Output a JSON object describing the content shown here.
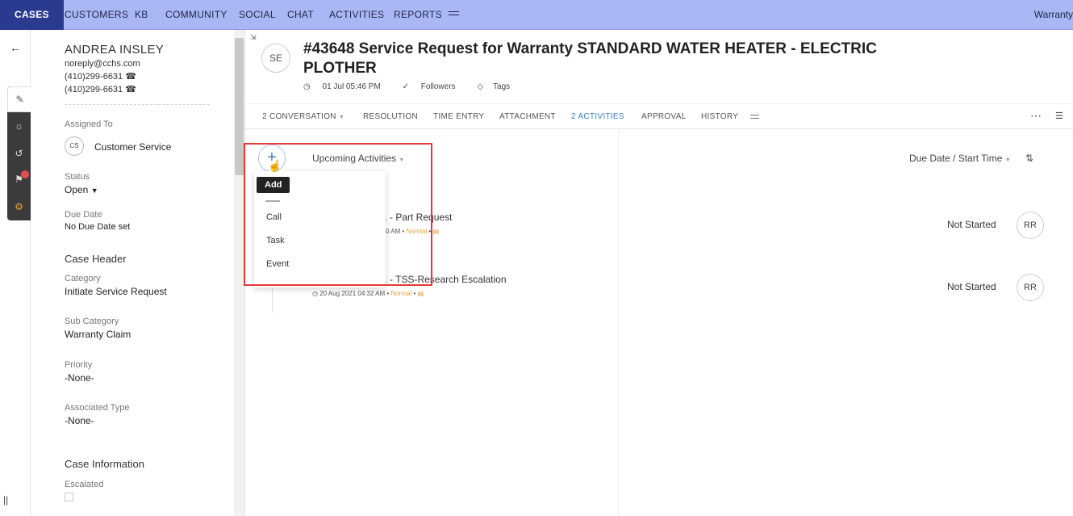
{
  "topnav": {
    "active": "CASES",
    "tabs": [
      "CUSTOMERS",
      "KB",
      "COMMUNITY",
      "SOCIAL",
      "CHAT",
      "ACTIVITIES",
      "REPORTS"
    ],
    "right_text": "Warranty"
  },
  "contact": {
    "name": "ANDREA INSLEY",
    "email": "noreply@cchs.com",
    "phone1": "(410)299-6631",
    "phone2": "(410)299-6631"
  },
  "fields": {
    "assigned_label": "Assigned To",
    "assigned_initials": "CS",
    "assigned_value": "Customer Service",
    "status_label": "Status",
    "status_value": "Open",
    "due_label": "Due Date",
    "due_value": "No Due Date set",
    "case_header": "Case Header",
    "category_label": "Category",
    "category_value": "Initiate Service Request",
    "subcategory_label": "Sub Category",
    "subcategory_value": "Warranty Claim",
    "priority_label": "Priority",
    "priority_value": "-None-",
    "assoc_label": "Associated Type",
    "assoc_value": "-None-",
    "case_info": "Case Information",
    "escalated_label": "Escalated"
  },
  "ticket": {
    "avatar": "SE",
    "title": "#43648  Service Request for Warranty STANDARD WATER HEATER - ELECTRIC PLOTHER",
    "date": "01 Jul 05:46 PM",
    "followers": "Followers",
    "tags": "Tags"
  },
  "tabs": {
    "conversation": "2  CONVERSATION",
    "resolution": "RESOLUTION",
    "time_entry": "TIME ENTRY",
    "attachment": "ATTACHMENT",
    "activities": "2  ACTIVITIES",
    "approval": "APPROVAL",
    "history": "HISTORY"
  },
  "activities": {
    "filter": "Upcoming Activities",
    "sort": "Due Date / Start Time",
    "items": [
      {
        "title": "-1 - Part Request",
        "time": "0 AM",
        "priority": "Normal",
        "status": "Not Started",
        "owner": "RR"
      },
      {
        "title": "-1 - TSS-Research Escalation",
        "time": "20 Aug 2021 04:32 AM",
        "priority": "Normal",
        "status": "Not Started",
        "owner": "RR"
      }
    ]
  },
  "menu": {
    "tooltip": "Add",
    "items": [
      "Call",
      "Task",
      "Event"
    ]
  },
  "colors": {
    "nav_bg": "#a9b8f5",
    "nav_active": "#2a3a8f",
    "accent": "#3b82c4",
    "highlight": "#e53935",
    "priority": "#e8a33d"
  }
}
